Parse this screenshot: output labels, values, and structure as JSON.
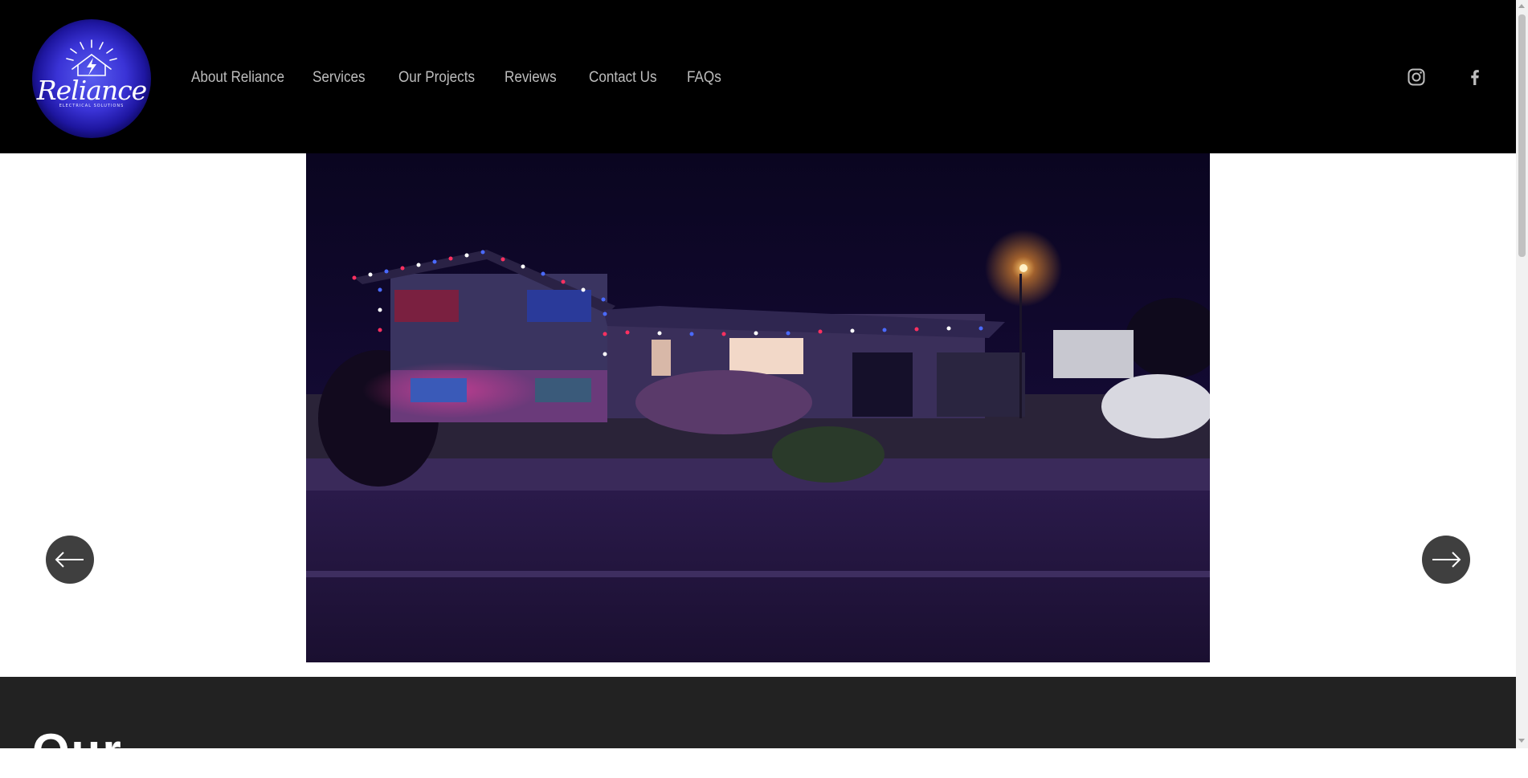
{
  "header": {
    "logo": {
      "brand_text": "Reliance",
      "tagline": "ELECTRICAL SOLUTIONS",
      "icon": "house-sun-bolt-logo"
    },
    "nav": [
      {
        "label": "About Reliance"
      },
      {
        "label": "Services"
      },
      {
        "label": "Our Projects"
      },
      {
        "label": "Reviews"
      },
      {
        "label": "Contact Us"
      },
      {
        "label": "FAQs"
      }
    ],
    "social": [
      {
        "icon": "instagram-icon"
      },
      {
        "icon": "facebook-icon"
      }
    ]
  },
  "gallery": {
    "slide_image": "house-with-red-white-blue-permanent-lights-at-night",
    "prev_icon": "arrow-left-icon",
    "next_icon": "arrow-right-icon"
  },
  "footer": {
    "heading_partial": "Our"
  },
  "colors": {
    "header_bg": "#000000",
    "nav_text": "#bdbdbd",
    "footer_bg": "#222222",
    "arrow_bg": "#3f3f3f",
    "logo_blue": "#3a33d6"
  }
}
